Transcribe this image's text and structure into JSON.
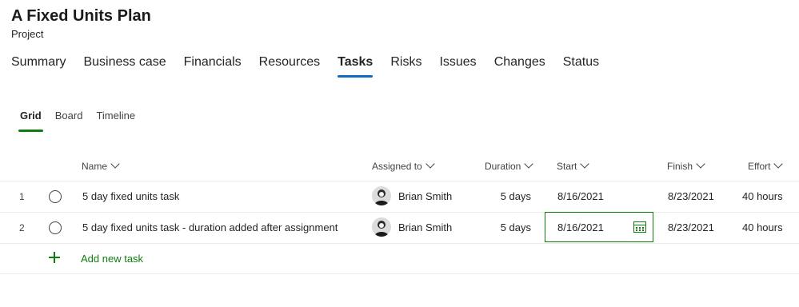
{
  "project": {
    "title": "A Fixed Units Plan",
    "type": "Project"
  },
  "tabs": [
    {
      "label": "Summary"
    },
    {
      "label": "Business case"
    },
    {
      "label": "Financials"
    },
    {
      "label": "Resources"
    },
    {
      "label": "Tasks",
      "active": true
    },
    {
      "label": "Risks"
    },
    {
      "label": "Issues"
    },
    {
      "label": "Changes"
    },
    {
      "label": "Status"
    }
  ],
  "views": [
    {
      "label": "Grid",
      "active": true
    },
    {
      "label": "Board"
    },
    {
      "label": "Timeline"
    }
  ],
  "columns": {
    "name": "Name",
    "assigned": "Assigned to",
    "duration": "Duration",
    "start": "Start",
    "finish": "Finish",
    "effort": "Effort"
  },
  "rows": [
    {
      "num": "1",
      "name": "5 day fixed units task",
      "assigned": "Brian Smith",
      "duration": "5 days",
      "start": "8/16/2021",
      "finish": "8/23/2021",
      "effort": "40 hours"
    },
    {
      "num": "2",
      "name": "5 day fixed units task - duration added after assignment",
      "assigned": "Brian Smith",
      "duration": "5 days",
      "start": "8/16/2021",
      "finish": "8/23/2021",
      "effort": "40 hours"
    }
  ],
  "add_task_label": "Add new task",
  "colors": {
    "accent_blue": "#0f6cbd",
    "accent_green": "#107c10"
  }
}
